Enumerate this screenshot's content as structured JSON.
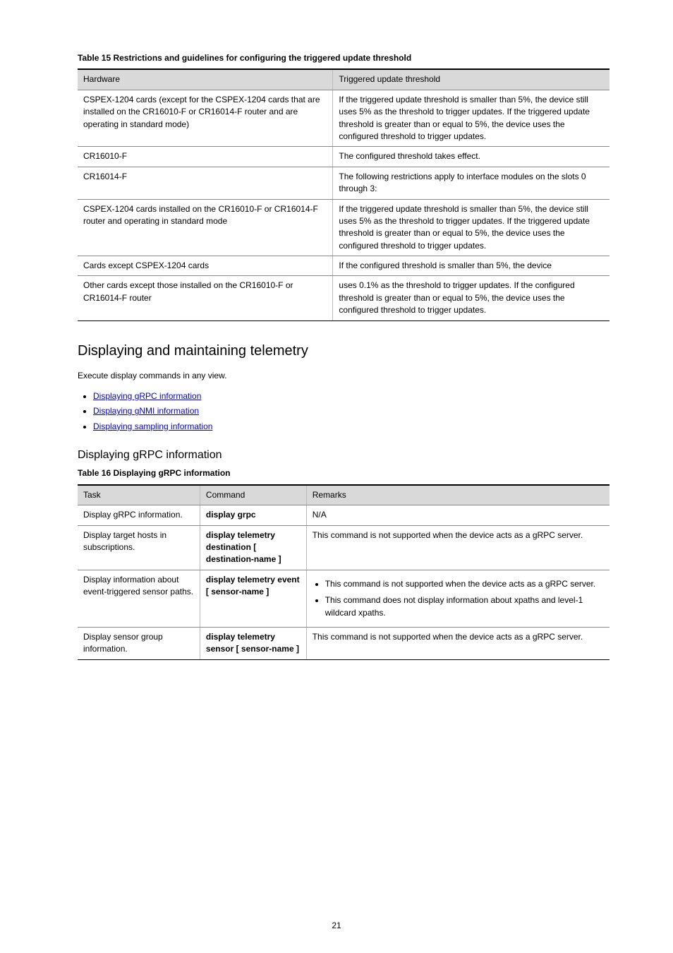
{
  "table1": {
    "caption": "Table 15 Restrictions and guidelines for configuring the triggered update threshold",
    "head": [
      "Hardware",
      "Triggered update threshold"
    ],
    "rows": [
      {
        "c1": "CSPEX-1204 cards (except for the CSPEX-1204 cards that are installed on the CR16010-F or CR16014-F router and are operating in standard mode)",
        "c2": "If the triggered update threshold is smaller than 5%, the device still uses 5% as the threshold to trigger updates. If the triggered update threshold is greater than or equal to 5%, the device uses the configured threshold to trigger updates."
      },
      {
        "c1": "CR16010-F",
        "c2": "The configured threshold takes effect."
      },
      {
        "c1": "CR16014-F",
        "c2": "The following restrictions apply to interface modules on the slots 0 through 3:"
      },
      {
        "c1": "CSPEX-1204 cards installed on the CR16010-F or CR16014-F router and operating in standard mode",
        "c2": "If the triggered update threshold is smaller than 5%, the device still uses 5% as the threshold to trigger updates. If the triggered update threshold is greater than or equal to 5%, the device uses the configured threshold to trigger updates."
      },
      {
        "c1": "Cards except CSPEX-1204 cards",
        "c2": "If the configured threshold is smaller than 5%, the device"
      },
      {
        "c1": "Other cards except those installed on the CR16010-F or CR16014-F router",
        "c2": "uses 0.1% as the threshold to trigger updates. If the configured threshold is greater than or equal to 5%, the device uses the configured threshold to trigger updates."
      }
    ]
  },
  "section": {
    "title": "Displaying and maintaining telemetry",
    "intro_label": "Execute display commands in any view.",
    "links": [
      "Displaying gRPC information",
      "Displaying gNMI information",
      "Displaying sampling information"
    ]
  },
  "subsection": {
    "title": "Displaying gRPC information",
    "caption": "Table 16 Displaying gRPC information"
  },
  "table2": {
    "head": [
      "Task",
      "Command",
      "Remarks"
    ],
    "rows": [
      {
        "task": "Display gRPC information.",
        "cmd": "display grpc",
        "rem": "N/A"
      },
      {
        "task": "Display target hosts in subscriptions.",
        "cmd": "display telemetry destination [ destination-name ]",
        "rem": "This command is not supported when the device acts as a gRPC server."
      },
      {
        "task": "Display information about event-triggered sensor paths.",
        "cmd": "display telemetry event [ sensor-name ]",
        "rem_list": [
          "This command is not supported when the device acts as a gRPC server.",
          "This command does not display information about xpaths and level-1 wildcard xpaths."
        ]
      },
      {
        "task": "Display sensor group information.",
        "cmd": "display telemetry sensor [ sensor-name ]",
        "rem": "This command is not supported when the device acts as a gRPC server."
      }
    ]
  },
  "page_number": "21"
}
